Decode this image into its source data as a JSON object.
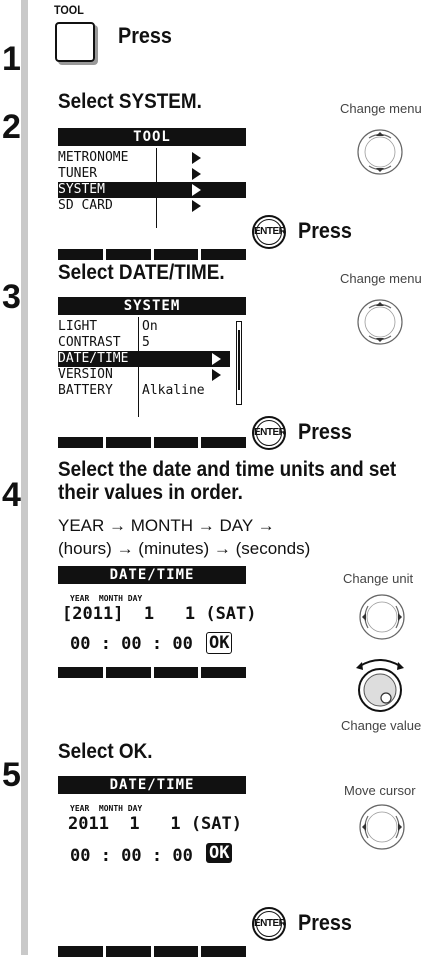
{
  "steps": {
    "s1": {
      "num": "1",
      "tool_label": "TOOL",
      "press": "Press"
    },
    "s2": {
      "num": "2",
      "title": "Select SYSTEM.",
      "lcd_title": "TOOL",
      "rows": [
        "METRONOME",
        "TUNER",
        "SYSTEM",
        "SD CARD"
      ],
      "knob_caption": "Change menu",
      "enter_label": "ENTER",
      "press": "Press"
    },
    "s3": {
      "num": "3",
      "title": "Select DATE/TIME.",
      "lcd_title": "SYSTEM",
      "rows": [
        {
          "label": "LIGHT",
          "value": "On"
        },
        {
          "label": "CONTRAST",
          "value": "5"
        },
        {
          "label": "DATE/TIME",
          "value": ""
        },
        {
          "label": "VERSION",
          "value": ""
        },
        {
          "label": "BATTERY",
          "value": "Alkaline"
        }
      ],
      "knob_caption": "Change menu",
      "enter_label": "ENTER",
      "press": "Press"
    },
    "s4": {
      "num": "4",
      "title_line1": "Select the date and time units and set",
      "title_line2": "their values in order.",
      "seq_line1": "YEAR → MONTH → DAY →",
      "seq_line2": "(hours) → (minutes) → (seconds)",
      "lcd_title": "DATE/TIME",
      "small_labels": "YEAR  MONTH DAY",
      "date_year": "2011",
      "date_rest": "  1   1 (SAT)",
      "time": "00 : 00 : 00",
      "ok": "OK",
      "caption_unit": "Change unit",
      "caption_value": "Change value"
    },
    "s5": {
      "num": "5",
      "title": "Select OK.",
      "lcd_title": "DATE/TIME",
      "small_labels": "YEAR  MONTH DAY",
      "date": "2011  1   1 (SAT)",
      "time": "00 : 00 : 00",
      "ok": "OK",
      "caption_cursor": "Move cursor",
      "enter_label": "ENTER",
      "press": "Press"
    }
  }
}
